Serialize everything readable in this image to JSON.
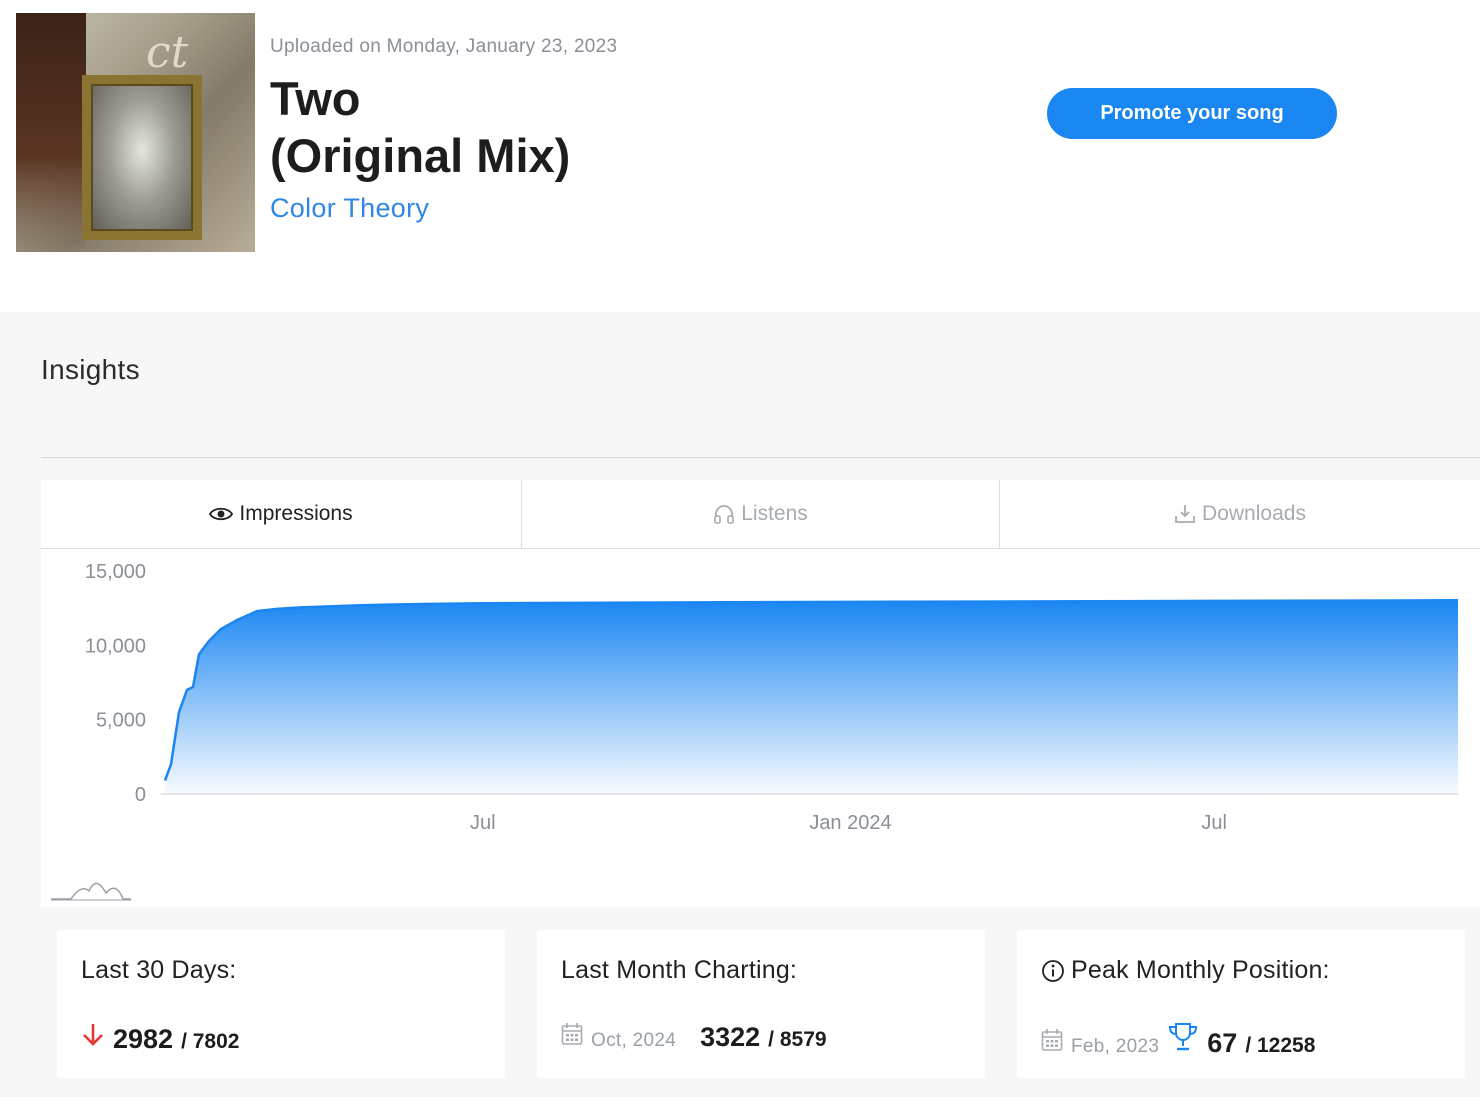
{
  "song": {
    "upload_date": "Uploaded on Monday, January 23, 2023",
    "title_line1": "Two",
    "title_line2": "(Original Mix)",
    "artist": "Color Theory",
    "promote_label": "Promote your song"
  },
  "insights": {
    "title": "Insights",
    "tabs": [
      {
        "label": "Impressions",
        "icon": "eye-icon",
        "active": true
      },
      {
        "label": "Listens",
        "icon": "headphones-icon",
        "active": false
      },
      {
        "label": "Downloads",
        "icon": "download-icon",
        "active": false
      }
    ]
  },
  "chart_data": {
    "type": "area",
    "title": "",
    "xlabel": "",
    "ylabel": "",
    "ylim": [
      0,
      15000
    ],
    "y_ticks": [
      "15,000",
      "10,000",
      "5,000",
      "0"
    ],
    "y_tick_values": [
      15000,
      10000,
      5000,
      0
    ],
    "x_ticks": [
      "Jul",
      "Jan 2024",
      "Jul"
    ],
    "x_tick_dates": [
      "2023-07-01",
      "2024-01-01",
      "2024-07-01"
    ],
    "color": "#1a86f2",
    "grid": false,
    "series": [
      {
        "x": [
          "2023-01-23",
          "2023-01-26",
          "2023-01-30",
          "2023-02-03",
          "2023-02-06",
          "2023-02-09",
          "2023-02-14",
          "2023-02-20",
          "2023-02-28",
          "2023-03-10",
          "2023-03-20",
          "2023-04-01",
          "2023-04-15",
          "2023-05-01",
          "2023-06-01",
          "2023-07-01",
          "2023-09-01",
          "2023-11-01",
          "2024-01-01",
          "2024-03-01",
          "2024-05-01",
          "2024-07-01",
          "2024-09-01",
          "2024-10-31"
        ],
        "values": [
          900,
          2000,
          5500,
          7000,
          7200,
          9400,
          10300,
          11100,
          11700,
          12300,
          12450,
          12550,
          12620,
          12700,
          12780,
          12830,
          12870,
          12900,
          12920,
          12940,
          12960,
          12990,
          13010,
          13030
        ]
      }
    ]
  },
  "stats": {
    "last30": {
      "title": "Last 30 Days:",
      "value": "2982",
      "total": "/ 7802",
      "trend": "down"
    },
    "last_month": {
      "title": "Last Month Charting:",
      "date": "Oct, 2024",
      "value": "3322",
      "total": "/ 8579"
    },
    "peak": {
      "title": "Peak Monthly Position:",
      "date": "Feb, 2023",
      "value": "67",
      "total": "/ 12258"
    }
  }
}
